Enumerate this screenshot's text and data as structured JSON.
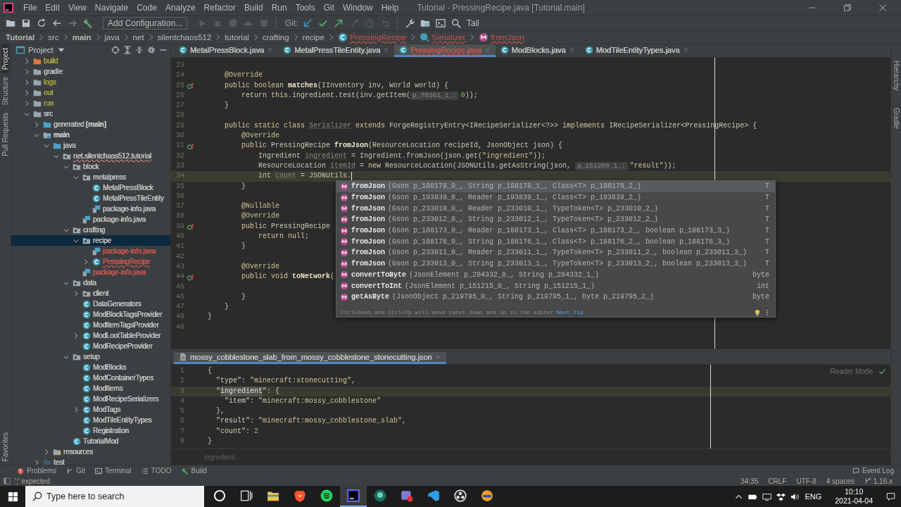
{
  "title_bar": {
    "menu": [
      "File",
      "Edit",
      "View",
      "Navigate",
      "Code",
      "Analyze",
      "Refactor",
      "Build",
      "Run",
      "Tools",
      "Git",
      "Window",
      "Help"
    ],
    "title": "Tutorial - PressingRecipe.java [Tutorial.main]"
  },
  "toolbar": {
    "left": [
      {
        "kind": "open",
        "disabled": false
      },
      {
        "kind": "save",
        "disabled": false
      },
      {
        "kind": "sync",
        "disabled": false
      },
      {
        "kind": "back",
        "disabled": false
      },
      {
        "kind": "forward",
        "disabled": true
      },
      {
        "kind": "build",
        "disabled": false
      }
    ],
    "run_config": "Add Configuration...",
    "run": [
      {
        "kind": "run",
        "disabled": true
      },
      {
        "kind": "debug",
        "disabled": true
      },
      {
        "kind": "coverage",
        "disabled": true
      },
      {
        "kind": "profile",
        "disabled": true
      },
      {
        "kind": "stop",
        "disabled": true
      }
    ],
    "git_label": "Git:",
    "git": [
      {
        "kind": "update",
        "disabled": false
      },
      {
        "kind": "commit",
        "disabled": false
      },
      {
        "kind": "push",
        "disabled": false
      },
      {
        "kind": "branch",
        "disabled": true
      },
      {
        "kind": "history",
        "disabled": true
      },
      {
        "kind": "rollback",
        "disabled": true
      }
    ],
    "right": [
      {
        "kind": "wrench",
        "disabled": false
      },
      {
        "kind": "structure",
        "disabled": false
      },
      {
        "kind": "terminal",
        "disabled": false
      },
      {
        "kind": "search",
        "disabled": false
      }
    ],
    "tail": "Tail"
  },
  "breadcrumb": [
    {
      "label": "Tutorial",
      "kind": "bold",
      "error": false
    },
    {
      "label": "src",
      "kind": "plain",
      "error": false
    },
    {
      "label": "main",
      "kind": "bold",
      "error": false
    },
    {
      "label": "java",
      "kind": "plain",
      "error": false
    },
    {
      "label": "net",
      "kind": "plain",
      "error": false
    },
    {
      "label": "silentchaos512",
      "kind": "plain",
      "error": false
    },
    {
      "label": "tutorial",
      "kind": "plain",
      "error": false
    },
    {
      "label": "crafting",
      "kind": "plain",
      "error": false
    },
    {
      "label": "recipe",
      "kind": "plain",
      "error": false
    },
    {
      "label": "PressingRecipe",
      "kind": "class",
      "error": true
    },
    {
      "label": "Serializer",
      "kind": "inner-class",
      "error": true
    },
    {
      "label": "fromJson",
      "kind": "method",
      "error": true
    }
  ],
  "left_tabs": [
    {
      "label": "Project",
      "selected": true
    },
    {
      "label": "Structure",
      "selected": false
    },
    {
      "label": "Pull Requests",
      "selected": false
    },
    {
      "label": "Favorites",
      "selected": false
    }
  ],
  "right_tabs": [
    {
      "label": "Hierarchy"
    },
    {
      "label": "Gradle"
    }
  ],
  "project": {
    "title": "Project",
    "tree": [
      {
        "label": "build",
        "kind": "excluded-folder",
        "color": "#9e9e3d",
        "error": false,
        "expanded": false,
        "selected": false
      },
      {
        "label": "gradle",
        "kind": "folder",
        "color": "#bbbbbb",
        "error": false,
        "expanded": false,
        "selected": false
      },
      {
        "label": "logs",
        "kind": "folder",
        "color": "#9e9e3d",
        "error": false,
        "expanded": false,
        "selected": false
      },
      {
        "label": "out",
        "kind": "folder",
        "color": "#9e9e3d",
        "error": false,
        "expanded": false,
        "selected": false
      },
      {
        "label": "run",
        "kind": "folder",
        "color": "#9e9e3d",
        "error": false,
        "expanded": false,
        "selected": false
      },
      {
        "label": "src",
        "kind": "folder",
        "color": "#bbbbbb",
        "error": false,
        "expanded": true,
        "selected": false,
        "children": [
          {
            "label": "generated **[main]**",
            "kind": "source-folder",
            "color": "#bbbbbb",
            "error": false,
            "expanded": false,
            "selected": false
          },
          {
            "label": "main",
            "kind": "module",
            "color": "#bbbbbb",
            "error": false,
            "expanded": true,
            "selected": false,
            "children": [
              {
                "label": "java",
                "kind": "source-folder",
                "color": "#bbbbbb",
                "error": false,
                "expanded": true,
                "selected": false,
                "children": [
                  {
                    "label": "net.silentchaos512.tutorial",
                    "kind": "package",
                    "color": "#bbbbbb",
                    "error": true,
                    "expanded": true,
                    "selected": false,
                    "children": [
                      {
                        "label": "block",
                        "kind": "package",
                        "color": "#bbbbbb",
                        "error": false,
                        "expanded": true,
                        "selected": false,
                        "children": [
                          {
                            "label": "metalpress",
                            "kind": "package",
                            "color": "#bbbbbb",
                            "error": false,
                            "expanded": true,
                            "selected": false,
                            "children": [
                              {
                                "label": "MetalPressBlock",
                                "kind": "class",
                                "color": "#bbbbbb",
                                "error": false,
                                "selected": false
                              },
                              {
                                "label": "MetalPressTileEntity",
                                "kind": "class",
                                "color": "#bbbbbb",
                                "error": false,
                                "selected": false
                              },
                              {
                                "label": "package-info.java",
                                "kind": "package-info",
                                "color": "#bbbbbb",
                                "error": false,
                                "selected": false
                              }
                            ]
                          },
                          {
                            "label": "package-info.java",
                            "kind": "package-info",
                            "color": "#bbbbbb",
                            "error": false,
                            "selected": false
                          }
                        ]
                      },
                      {
                        "label": "crafting",
                        "kind": "package",
                        "color": "#bbbbbb",
                        "error": false,
                        "expanded": true,
                        "selected": false,
                        "children": [
                          {
                            "label": "recipe",
                            "kind": "package",
                            "color": "#bbbbbb",
                            "error": false,
                            "expanded": true,
                            "selected": true,
                            "children": [
                              {
                                "label": "package-info.java",
                                "kind": "package-info",
                                "color": "#c75450",
                                "error": false,
                                "selected": false
                              },
                              {
                                "label": "PressingRecipe",
                                "kind": "class",
                                "color": "#c75450",
                                "error": true,
                                "expanded": false,
                                "selected": false
                              }
                            ]
                          },
                          {
                            "label": "package-info.java",
                            "kind": "package-info",
                            "color": "#c75450",
                            "error": false,
                            "selected": false
                          }
                        ]
                      },
                      {
                        "label": "data",
                        "kind": "package",
                        "color": "#bbbbbb",
                        "error": false,
                        "expanded": true,
                        "selected": false,
                        "children": [
                          {
                            "label": "client",
                            "kind": "package",
                            "color": "#bbbbbb",
                            "error": false,
                            "expanded": false,
                            "selected": false
                          },
                          {
                            "label": "DataGenerators",
                            "kind": "class",
                            "color": "#bbbbbb",
                            "error": false,
                            "selected": false
                          },
                          {
                            "label": "ModBlockTagsProvider",
                            "kind": "class",
                            "color": "#bbbbbb",
                            "error": false,
                            "selected": false
                          },
                          {
                            "label": "ModItemTagsProvider",
                            "kind": "class",
                            "color": "#bbbbbb",
                            "error": false,
                            "selected": false
                          },
                          {
                            "label": "ModLootTableProvider",
                            "kind": "class",
                            "color": "#bbbbbb",
                            "error": false,
                            "expanded": false,
                            "selected": false
                          },
                          {
                            "label": "ModRecipeProvider",
                            "kind": "class",
                            "color": "#bbbbbb",
                            "error": false,
                            "selected": false
                          }
                        ]
                      },
                      {
                        "label": "setup",
                        "kind": "package",
                        "color": "#bbbbbb",
                        "error": false,
                        "expanded": true,
                        "selected": false,
                        "children": [
                          {
                            "label": "ModBlocks",
                            "kind": "class",
                            "color": "#bbbbbb",
                            "error": false,
                            "selected": false
                          },
                          {
                            "label": "ModContainerTypes",
                            "kind": "class",
                            "color": "#bbbbbb",
                            "error": false,
                            "selected": false
                          },
                          {
                            "label": "ModItems",
                            "kind": "class",
                            "color": "#bbbbbb",
                            "error": false,
                            "selected": false
                          },
                          {
                            "label": "ModRecipeSerializers",
                            "kind": "class",
                            "color": "#bbbbbb",
                            "error": false,
                            "selected": false
                          },
                          {
                            "label": "ModTags",
                            "kind": "class",
                            "color": "#bbbbbb",
                            "error": false,
                            "expanded": false,
                            "selected": false
                          },
                          {
                            "label": "ModTileEntityTypes",
                            "kind": "class",
                            "color": "#bbbbbb",
                            "error": false,
                            "selected": false
                          },
                          {
                            "label": "Registration",
                            "kind": "class",
                            "color": "#bbbbbb",
                            "error": false,
                            "selected": false
                          }
                        ]
                      },
                      {
                        "label": "TutorialMod",
                        "kind": "class",
                        "color": "#bbbbbb",
                        "error": false,
                        "selected": false
                      }
                    ]
                  }
                ]
              },
              {
                "label": "resources",
                "kind": "resources-folder",
                "color": "#bbbbbb",
                "error": false,
                "expanded": false,
                "selected": false
              }
            ]
          },
          {
            "label": "test",
            "kind": "test-folder",
            "color": "#bbbbbb",
            "error": false,
            "expanded": false,
            "selected": false
          }
        ]
      }
    ]
  },
  "editor": {
    "tabs": [
      {
        "label": "MetalPressBlock.java",
        "selected": false,
        "color": "#bbbbbb",
        "error": false
      },
      {
        "label": "MetalPressTileEntity.java",
        "selected": false,
        "color": "#bbbbbb",
        "error": false
      },
      {
        "label": "PressingRecipe.java",
        "selected": true,
        "color": "#c75450",
        "error": true
      },
      {
        "label": "ModBlocks.java",
        "selected": false,
        "color": "#bbbbbb",
        "error": false
      },
      {
        "label": "ModTileEntityTypes.java",
        "selected": false,
        "color": "#bbbbbb",
        "error": false
      }
    ],
    "lines": [
      {
        "number": "23",
        "override": false,
        "current": false,
        "caret": false
      },
      {
        "number": "24",
        "override": false,
        "current": false,
        "caret": false,
        "tokens": [
          {
            "kind": "ann",
            "text": "    @Override"
          }
        ]
      },
      {
        "number": "25",
        "override": true,
        "current": false,
        "caret": false,
        "tokens": [
          {
            "kind": "kw",
            "text": "    public boolean "
          },
          {
            "kind": "fn",
            "text": "matches"
          },
          {
            "kind": "plain",
            "text": "(IInventory inv, World world) {"
          }
        ]
      },
      {
        "number": "26",
        "override": false,
        "current": false,
        "caret": false,
        "tokens": [
          {
            "kind": "kw",
            "text": "        return this"
          },
          {
            "kind": "plain",
            "text": ".ingredient.test(inv.getItem("
          },
          {
            "kind": "hint",
            "text": "p_70301_1_:"
          },
          {
            "kind": "num",
            "text": "0"
          },
          {
            "kind": "plain",
            "text": "));"
          }
        ]
      },
      {
        "number": "27",
        "override": false,
        "current": false,
        "caret": false,
        "tokens": [
          {
            "kind": "plain",
            "text": "    }"
          }
        ]
      },
      {
        "number": "28",
        "override": false,
        "current": false,
        "caret": false
      },
      {
        "number": "29",
        "override": false,
        "current": false,
        "caret": false,
        "tokens": [
          {
            "kind": "kw",
            "text": "    public static class "
          },
          {
            "kind": "unused",
            "text": "Serializer"
          },
          {
            "kind": "kw",
            "text": " extends "
          },
          {
            "kind": "plain",
            "text": "ForgeRegistryEntry<IRecipeSerializer<?>> "
          },
          {
            "kind": "kw",
            "text": "implements "
          },
          {
            "kind": "plain",
            "text": "IRecipeSerializer<PressingRecipe> {"
          }
        ]
      },
      {
        "number": "30",
        "override": false,
        "current": false,
        "caret": false,
        "tokens": [
          {
            "kind": "ann",
            "text": "        @Override"
          }
        ]
      },
      {
        "number": "31",
        "override": true,
        "current": false,
        "caret": false,
        "tokens": [
          {
            "kind": "kw",
            "text": "        public "
          },
          {
            "kind": "plain",
            "text": "PressingRecipe "
          },
          {
            "kind": "fn",
            "text": "fromJson"
          },
          {
            "kind": "plain",
            "text": "(ResourceLocation recipeId, JsonObject json) {"
          }
        ]
      },
      {
        "number": "32",
        "override": false,
        "current": false,
        "caret": false,
        "tokens": [
          {
            "kind": "plain",
            "text": "            Ingredient "
          },
          {
            "kind": "unused",
            "text": "ingredient"
          },
          {
            "kind": "plain",
            "text": " = Ingredient.fromJson(json.get("
          },
          {
            "kind": "str",
            "text": "\"ingredient\""
          },
          {
            "kind": "plain",
            "text": "));"
          }
        ]
      },
      {
        "number": "33",
        "override": false,
        "current": false,
        "caret": false,
        "tokens": [
          {
            "kind": "plain",
            "text": "            ResourceLocation "
          },
          {
            "kind": "unused",
            "text": "itemId"
          },
          {
            "kind": "plain",
            "text": " = "
          },
          {
            "kind": "kw",
            "text": "new "
          },
          {
            "kind": "plain",
            "text": "ResourceLocation(JSONUtils.getAsString(json, "
          },
          {
            "kind": "hint",
            "text": "p_151200_1_:"
          },
          {
            "kind": "str",
            "text": "\"result\""
          },
          {
            "kind": "plain",
            "text": "));"
          }
        ]
      },
      {
        "number": "34",
        "override": false,
        "current": true,
        "caret": true,
        "tokens": [
          {
            "kind": "kw",
            "text": "            int "
          },
          {
            "kind": "unused",
            "text": "count"
          },
          {
            "kind": "plain",
            "text": " = JSONUtils."
          }
        ]
      },
      {
        "number": "35",
        "override": false,
        "current": false,
        "caret": false,
        "tokens": [
          {
            "kind": "plain",
            "text": "        }"
          }
        ]
      },
      {
        "number": "36",
        "override": false,
        "current": false,
        "caret": false
      },
      {
        "number": "37",
        "override": false,
        "current": false,
        "caret": false,
        "tokens": [
          {
            "kind": "ann",
            "text": "        @Nullable"
          }
        ]
      },
      {
        "number": "38",
        "override": false,
        "current": false,
        "caret": false,
        "tokens": [
          {
            "kind": "ann",
            "text": "        @Override"
          }
        ]
      },
      {
        "number": "39",
        "override": true,
        "current": false,
        "caret": false,
        "tokens": [
          {
            "kind": "kw",
            "text": "        public "
          },
          {
            "kind": "plain",
            "text": "PressingRecipe"
          }
        ]
      },
      {
        "number": "40",
        "override": false,
        "current": false,
        "caret": false,
        "tokens": [
          {
            "kind": "kw",
            "text": "            return null"
          },
          {
            "kind": "plain",
            "text": ";"
          }
        ]
      },
      {
        "number": "41",
        "override": false,
        "current": false,
        "caret": false,
        "tokens": [
          {
            "kind": "plain",
            "text": "        }"
          }
        ]
      },
      {
        "number": "42",
        "override": false,
        "current": false,
        "caret": false
      },
      {
        "number": "43",
        "override": false,
        "current": false,
        "caret": false,
        "tokens": [
          {
            "kind": "ann",
            "text": "        @Override"
          }
        ]
      },
      {
        "number": "44",
        "override": true,
        "current": false,
        "caret": false,
        "tokens": [
          {
            "kind": "kw",
            "text": "        public void "
          },
          {
            "kind": "fn",
            "text": "toNetwork"
          },
          {
            "kind": "plain",
            "text": "("
          }
        ]
      },
      {
        "number": "45",
        "override": false,
        "current": false,
        "caret": false
      },
      {
        "number": "46",
        "override": false,
        "current": false,
        "caret": false,
        "tokens": [
          {
            "kind": "plain",
            "text": "        }"
          }
        ]
      },
      {
        "number": "47",
        "override": false,
        "current": false,
        "caret": false,
        "tokens": [
          {
            "kind": "plain",
            "text": "    }"
          }
        ]
      },
      {
        "number": "48",
        "override": false,
        "current": false,
        "caret": false,
        "tokens": [
          {
            "kind": "plain",
            "text": "}"
          }
        ]
      },
      {
        "number": "49",
        "override": false,
        "current": false,
        "caret": false
      }
    ],
    "completion": {
      "items": [
        {
          "name": "fromJson",
          "params": "(Gson p_188178_0_, String p_188178_1_, Class<T> p_188178_2_)",
          "type": "T",
          "selected": true
        },
        {
          "name": "fromJson",
          "params": "(Gson p_193839_0_, Reader p_193839_1_, Class<T> p_193839_2_)",
          "type": "T",
          "selected": false
        },
        {
          "name": "fromJson",
          "params": "(Gson p_233010_0_, Reader p_233010_1_, TypeToken<T> p_233010_2_)",
          "type": "T",
          "selected": false
        },
        {
          "name": "fromJson",
          "params": "(Gson p_233012_0_, String p_233012_1_, TypeToken<T> p_233012_2_)",
          "type": "T",
          "selected": false
        },
        {
          "name": "fromJson",
          "params": "(Gson p_188173_0_, Reader p_188173_1_, Class<T> p_188173_2_, boolean p_188173_3_)",
          "type": "T",
          "selected": false
        },
        {
          "name": "fromJson",
          "params": "(Gson p_188176_0_, String p_188176_1_, Class<T> p_188176_2_, boolean p_188176_3_)",
          "type": "T",
          "selected": false
        },
        {
          "name": "fromJson",
          "params": "(Gson p_233011_0_, Reader p_233011_1_, TypeToken<T> p_233011_2_, boolean p_233011_3_)",
          "type": "T",
          "selected": false
        },
        {
          "name": "fromJson",
          "params": "(Gson p_233013_0_, String p_233013_1_, TypeToken<T> p_233013_2_, boolean p_233013_3_)",
          "type": "T",
          "selected": false
        },
        {
          "name": "convertToByte",
          "params": "(JsonElement p_204332_0_, String p_204332_1_)",
          "type": "byte",
          "selected": false
        },
        {
          "name": "convertToInt",
          "params": "(JsonElement p_151215_0_, String p_151215_1_)",
          "type": "int",
          "selected": false
        },
        {
          "name": "getAsByte",
          "params": "(JsonObject p_219795_0_, String p_219795_1_, byte p_219795_2_)",
          "type": "byte",
          "selected": false
        }
      ],
      "hint": "Ctrl+Down and Ctrl+Up will move caret down and up in the editor",
      "hint_link": "Next Tip"
    }
  },
  "json_editor": {
    "tab": "mossy_cobblestone_slab_from_mossy_cobblestone_stonecutting.json",
    "reader_mode": "Reader Mode",
    "lines": [
      {
        "number": "1",
        "current": false,
        "tokens": [
          {
            "kind": "plain",
            "text": "{"
          }
        ]
      },
      {
        "number": "2",
        "current": false,
        "tokens": [
          {
            "kind": "key",
            "text": "  \"type\""
          },
          {
            "kind": "plain",
            "text": ": "
          },
          {
            "kind": "str",
            "text": "\"minecraft:stonecutting\""
          },
          {
            "kind": "plain",
            "text": ","
          }
        ]
      },
      {
        "number": "3",
        "current": true,
        "tokens": [
          {
            "kind": "key",
            "text": "  \""
          },
          {
            "kind": "match",
            "text": "ingredient"
          },
          {
            "kind": "key",
            "text": "\""
          },
          {
            "kind": "plain",
            "text": ": {"
          }
        ]
      },
      {
        "number": "4",
        "current": false,
        "tokens": [
          {
            "kind": "key",
            "text": "    \"item\""
          },
          {
            "kind": "plain",
            "text": ": "
          },
          {
            "kind": "str",
            "text": "\"minecraft:mossy_cobblestone\""
          }
        ]
      },
      {
        "number": "5",
        "current": false,
        "tokens": [
          {
            "kind": "plain",
            "text": "  },"
          }
        ]
      },
      {
        "number": "6",
        "current": false,
        "tokens": [
          {
            "kind": "key",
            "text": "  \"result\""
          },
          {
            "kind": "plain",
            "text": ": "
          },
          {
            "kind": "str",
            "text": "\"minecraft:mossy_cobblestone_slab\""
          },
          {
            "kind": "plain",
            "text": ","
          }
        ]
      },
      {
        "number": "7",
        "current": false,
        "tokens": [
          {
            "kind": "key",
            "text": "  \"count\""
          },
          {
            "kind": "plain",
            "text": ": "
          },
          {
            "kind": "num",
            "text": "2"
          }
        ]
      },
      {
        "number": "8",
        "current": false,
        "tokens": [
          {
            "kind": "plain",
            "text": "}"
          }
        ]
      }
    ],
    "breadcrumb": "ingredient"
  },
  "tool_windows": [
    {
      "label": "Problems",
      "kind": "problems"
    },
    {
      "label": "Git",
      "kind": "git"
    },
    {
      "label": "Terminal",
      "kind": "terminal"
    },
    {
      "label": "TODO",
      "kind": "todo"
    },
    {
      "label": "Build",
      "kind": "build"
    }
  ],
  "event_log": "Event Log",
  "status_bar": {
    "message": "';' expected",
    "items": [
      "34:35",
      "CRLF",
      "UTF-8",
      "4 spaces"
    ],
    "branch": "1.16.x"
  },
  "taskbar": {
    "search_placeholder": "Type here to search",
    "apps": [
      {
        "kind": "cortana",
        "selected": false
      },
      {
        "kind": "taskview",
        "selected": false
      },
      {
        "kind": "explorer",
        "selected": false
      },
      {
        "kind": "brave",
        "selected": false
      },
      {
        "kind": "spotify",
        "selected": false
      },
      {
        "kind": "intellij",
        "selected": true
      },
      {
        "kind": "kraken",
        "selected": false
      },
      {
        "kind": "recorder",
        "selected": false
      },
      {
        "kind": "vscode",
        "selected": false
      },
      {
        "kind": "obs",
        "selected": false
      },
      {
        "kind": "capture",
        "selected": false
      }
    ],
    "language": "ENG",
    "time": "10:10",
    "date": "2021-04-04"
  }
}
